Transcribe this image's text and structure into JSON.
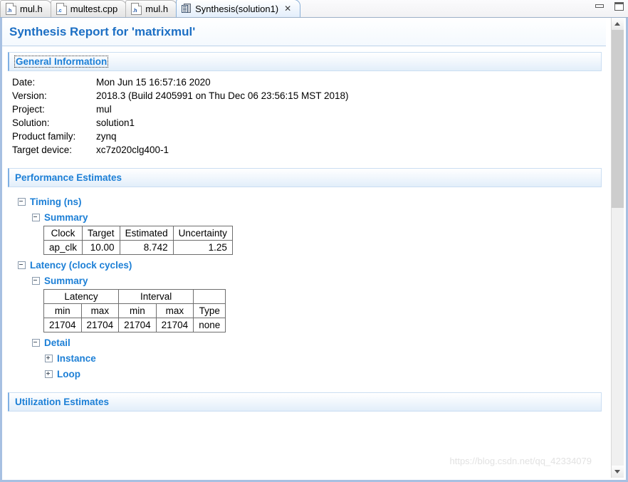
{
  "window": {
    "minimize_label": "Minimize",
    "maximize_label": "Maximize"
  },
  "tabs": [
    {
      "label": "mul.h",
      "icon": "h-file-icon",
      "kind": "h",
      "active": false
    },
    {
      "label": "multest.cpp",
      "icon": "c-file-icon",
      "kind": "c",
      "active": false
    },
    {
      "label": "mul.h",
      "icon": "h-file-icon",
      "kind": "h",
      "active": false
    },
    {
      "label": "Synthesis(solution1)",
      "icon": "report-icon",
      "kind": "report",
      "active": true,
      "close": "✕"
    }
  ],
  "report": {
    "title": "Synthesis Report for 'matrixmul'",
    "sections": {
      "general": {
        "header": "General Information",
        "rows": [
          {
            "key": "Date:",
            "value": "Mon Jun 15 16:57:16 2020"
          },
          {
            "key": "Version:",
            "value": "2018.3 (Build 2405991 on Thu Dec 06 23:56:15 MST 2018)"
          },
          {
            "key": "Project:",
            "value": "mul"
          },
          {
            "key": "Solution:",
            "value": "solution1"
          },
          {
            "key": "Product family:",
            "value": "zynq"
          },
          {
            "key": "Target device:",
            "value": "xc7z020clg400-1"
          }
        ]
      },
      "performance": {
        "header": "Performance Estimates",
        "timing": {
          "label": "Timing (ns)",
          "summary_label": "Summary",
          "columns": [
            "Clock",
            "Target",
            "Estimated",
            "Uncertainty"
          ],
          "rows": [
            [
              "ap_clk",
              "10.00",
              "8.742",
              "1.25"
            ]
          ]
        },
        "latency": {
          "label": "Latency (clock cycles)",
          "summary_label": "Summary",
          "group_headers": [
            "Latency",
            "Interval",
            ""
          ],
          "columns": [
            "min",
            "max",
            "min",
            "max",
            "Type"
          ],
          "rows": [
            [
              "21704",
              "21704",
              "21704",
              "21704",
              "none"
            ]
          ],
          "detail_label": "Detail",
          "detail_items": [
            "Instance",
            "Loop"
          ]
        }
      },
      "utilization": {
        "header": "Utilization Estimates"
      }
    }
  },
  "watermark": "https://blog.csdn.net/qq_42334079",
  "colors": {
    "accent": "#1c7fd6",
    "title": "#1c6fc4",
    "frame": "#a7c0e2"
  }
}
